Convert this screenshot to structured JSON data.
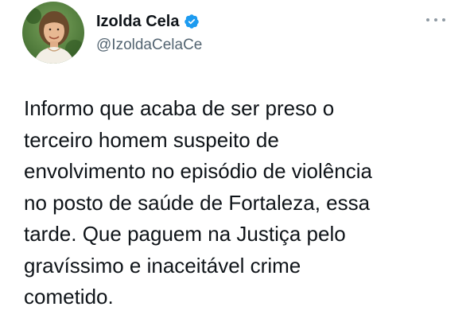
{
  "author": {
    "display_name": "Izolda Cela",
    "handle": "@IzoldaCelaCe",
    "verified": true,
    "avatar_icon": "profile-photo"
  },
  "actions": {
    "more_icon": "more-options-icon"
  },
  "tweet": {
    "text": "Informo que acaba de ser preso o\nterceiro homem suspeito de\nenvolvimento no episódio de violência\nno posto de saúde de Fortaleza, essa\ntarde. Que paguem na Justiça pelo\ngravíssimo e inaceitável crime\ncometido."
  },
  "colors": {
    "verified_blue": "#1d9bf0",
    "text_primary": "#0f1419",
    "text_secondary": "#536471"
  }
}
